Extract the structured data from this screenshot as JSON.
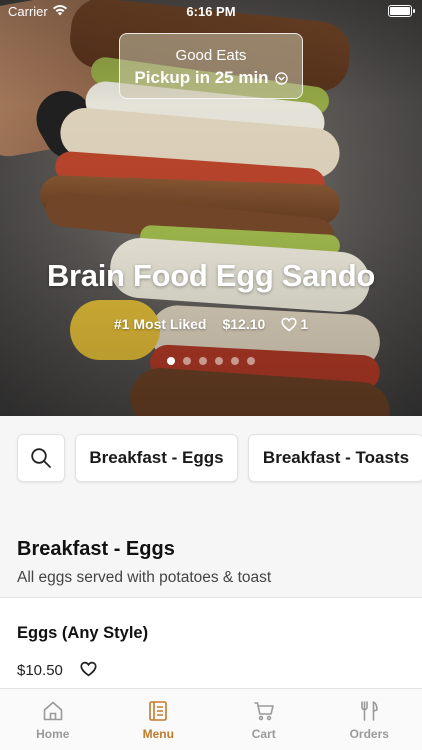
{
  "status_bar": {
    "carrier": "Carrier",
    "time": "6:16 PM"
  },
  "pickup": {
    "restaurant": "Good Eats",
    "eta": "Pickup in 25 min"
  },
  "featured": {
    "title": "Brain Food Egg Sando",
    "badge": "#1 Most Liked",
    "price": "$12.10",
    "likes": "1",
    "carousel_count": 6,
    "carousel_active_index": 0
  },
  "categories": [
    "Breakfast - Eggs",
    "Breakfast - Toasts"
  ],
  "section": {
    "title": "Breakfast - Eggs",
    "description": "All eggs served with potatoes & toast"
  },
  "items": [
    {
      "name": "Eggs (Any Style)",
      "price": "$10.50"
    }
  ],
  "tabs": [
    {
      "label": "Home",
      "icon": "home-icon",
      "active": false
    },
    {
      "label": "Menu",
      "icon": "menu-icon",
      "active": true
    },
    {
      "label": "Cart",
      "icon": "cart-icon",
      "active": false
    },
    {
      "label": "Orders",
      "icon": "fork-knife-icon",
      "active": false
    }
  ],
  "colors": {
    "accent": "#c47a2c",
    "tab_inactive": "#9a9a9a",
    "background": "#f6f6f6"
  }
}
